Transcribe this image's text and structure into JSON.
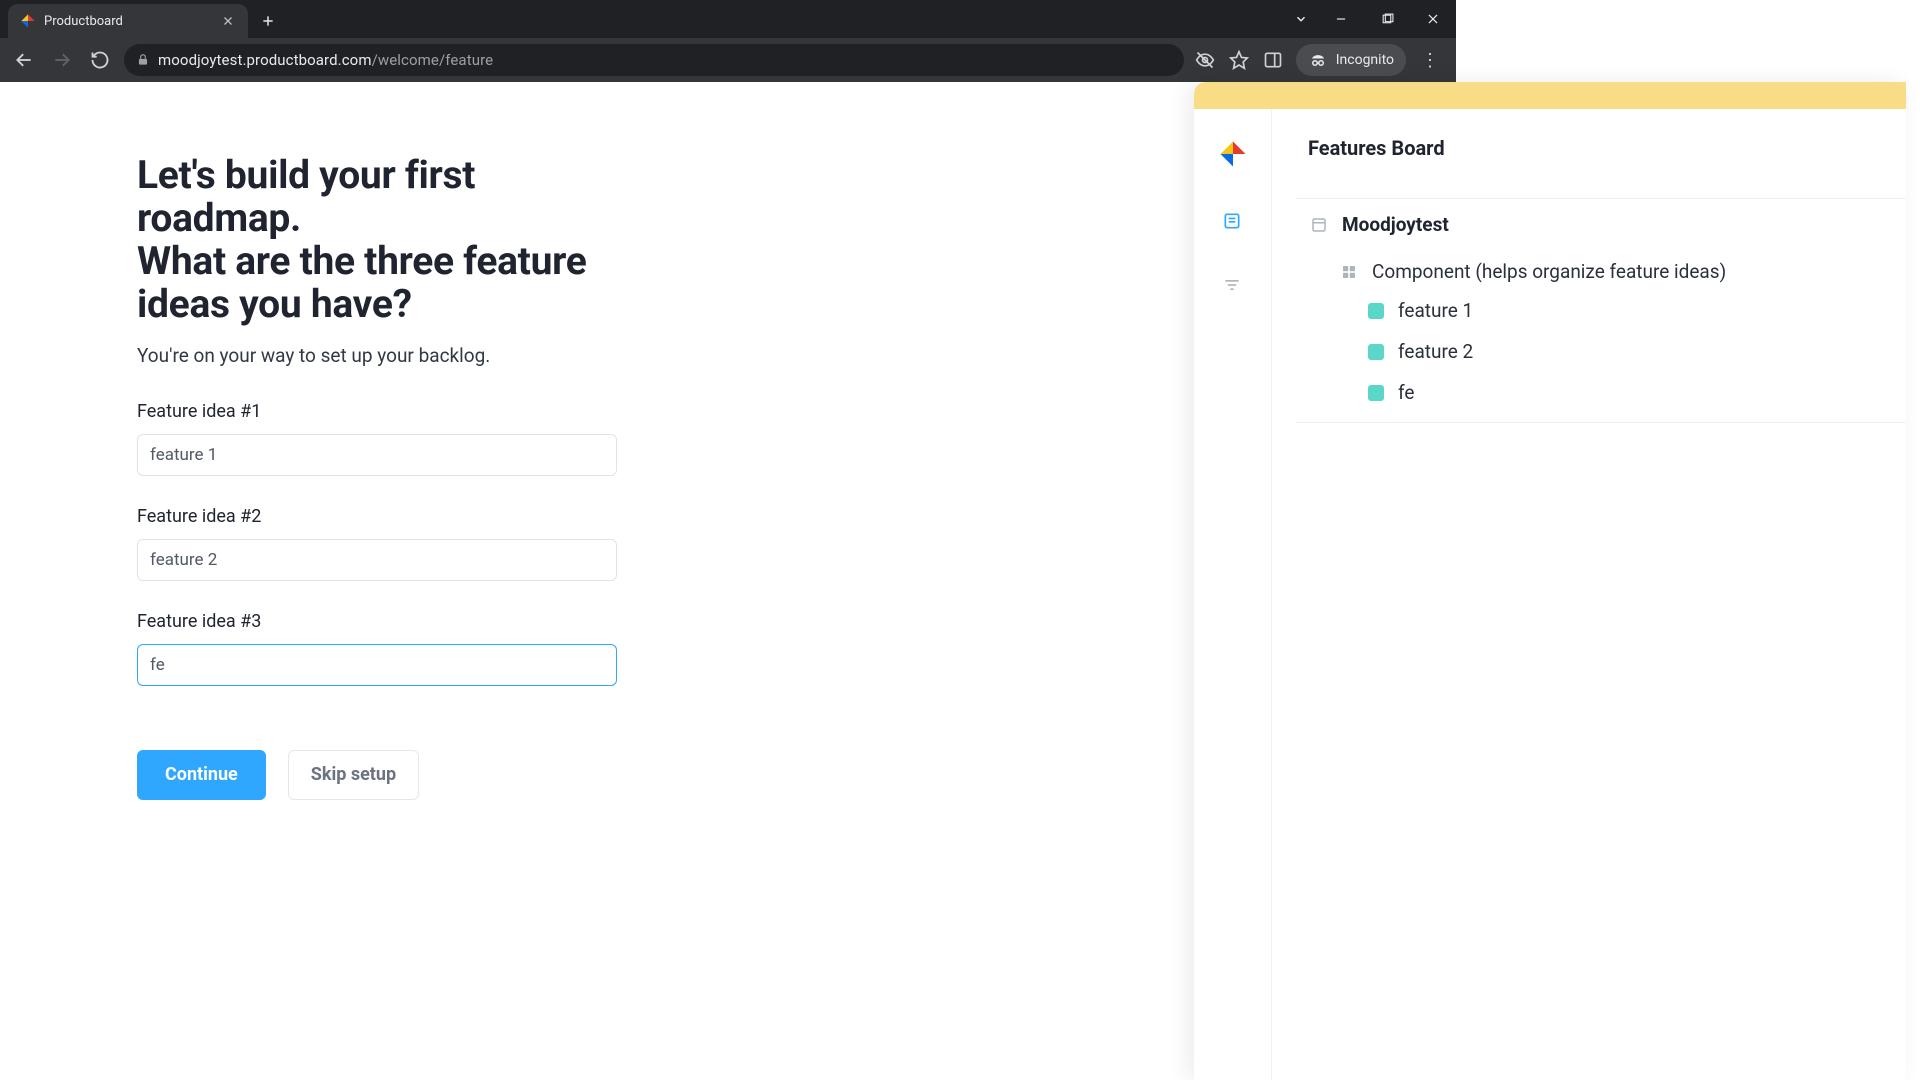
{
  "browser": {
    "tab_title": "Productboard",
    "url_host": "moodjoytest.productboard.com",
    "url_path": "/welcome/feature",
    "incognito_label": "Incognito"
  },
  "page": {
    "heading_line1": "Let's build your first roadmap.",
    "heading_line2": "What are the three feature ideas you have?",
    "subtext": "You're on your way to set up your backlog.",
    "fields": [
      {
        "label": "Feature idea #1",
        "value": "feature 1"
      },
      {
        "label": "Feature idea #2",
        "value": "feature 2"
      },
      {
        "label": "Feature idea #3",
        "value": "fe"
      }
    ],
    "continue_label": "Continue",
    "skip_label": "Skip setup"
  },
  "preview": {
    "title": "Features Board",
    "project_name": "Moodjoytest",
    "component_label": "Component (helps organize feature ideas)",
    "features": [
      "feature 1",
      "feature 2",
      "fe"
    ]
  },
  "colors": {
    "accent": "#2fa7ff",
    "feature_chip": "#5ad7c9",
    "preview_banner": "#f8dd86"
  }
}
